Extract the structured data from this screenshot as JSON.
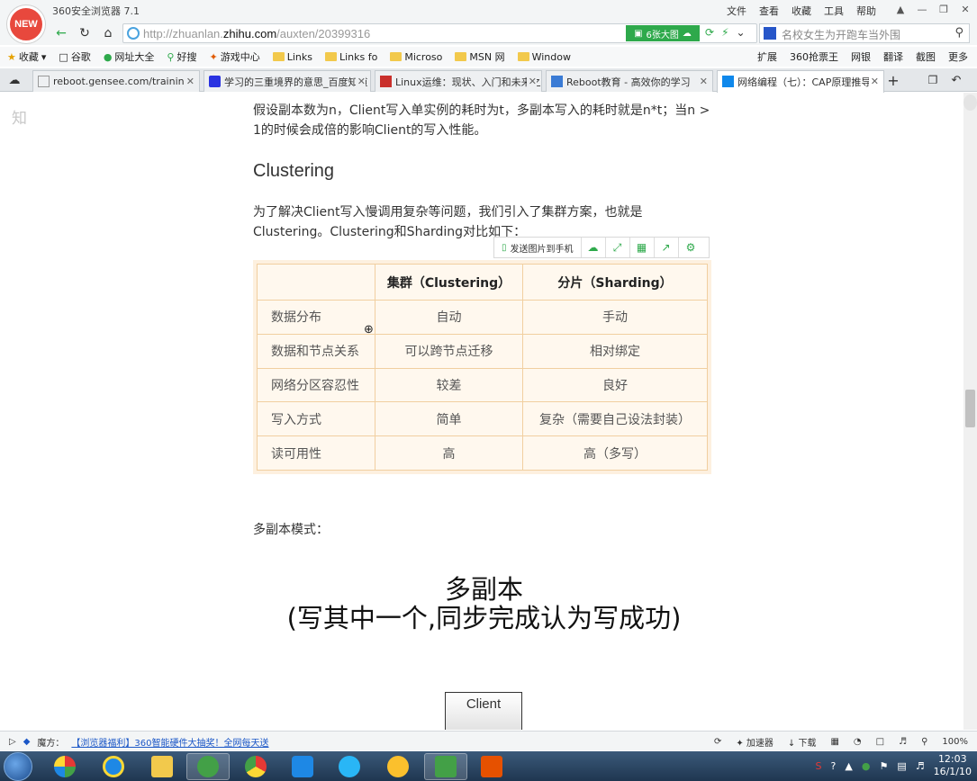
{
  "app": {
    "logo": "NEW",
    "title": "360安全浏览器 7.1"
  },
  "title_menu": [
    "文件",
    "查看",
    "收藏",
    "工具",
    "帮助"
  ],
  "window_controls": [
    "shirt-icon",
    "minimize",
    "maximize",
    "close"
  ],
  "address": {
    "url_prefix": "http://zhuanlan.",
    "url_domain": "zhihu.com",
    "url_path": "/auxten/20399316",
    "big_image_label": "6张大图",
    "search_placeholder": "名校女生为开跑车当外围"
  },
  "bookmarks": {
    "left": [
      {
        "label": "收藏",
        "icon": "star-icon"
      },
      {
        "label": "谷歌",
        "icon": "page-icon"
      },
      {
        "label": "网址大全",
        "icon": "globe-icon"
      },
      {
        "label": "好搜",
        "icon": "search-icon"
      },
      {
        "label": "游戏中心",
        "icon": "game-icon"
      },
      {
        "label": "Links",
        "icon": "folder-icon"
      },
      {
        "label": "Links fo",
        "icon": "folder-icon"
      },
      {
        "label": "Microso",
        "icon": "folder-icon"
      },
      {
        "label": "MSN 网",
        "icon": "folder-icon"
      },
      {
        "label": "Window",
        "icon": "folder-icon"
      }
    ],
    "right": [
      "扩展",
      "360抢票王",
      "网银",
      "翻译",
      "截图",
      "更多"
    ]
  },
  "tabs": [
    {
      "label": "reboot.gensee.com/training/"
    },
    {
      "label": "学习的三重境界的意思_百度知道"
    },
    {
      "label": "Linux运维：现状、入门和未来之路"
    },
    {
      "label": "Reboot教育 - 高效你的学习"
    },
    {
      "label": "网络编程（七）：CAP原理推导"
    }
  ],
  "article": {
    "site_logo": "知",
    "para1": "假设副本数为n，Client写入单实例的耗时为t，多副本写入的耗时就是n*t；当n > 1的时候会成倍的影响Client的写入性能。",
    "heading": "Clustering",
    "para2": "为了解决Client写入慢调用复杂等问题，我们引入了集群方案，也就是Clustering。Clustering和Sharding对比如下：",
    "image_toolbar": {
      "send_label": "发送图片到手机"
    },
    "table": {
      "headers": [
        "",
        "集群（Clustering）",
        "分片（Sharding）"
      ],
      "rows": [
        [
          "数据分布",
          "自动",
          "手动"
        ],
        [
          "数据和节点关系",
          "可以跨节点迁移",
          "相对绑定"
        ],
        [
          "网络分区容忍性",
          "较差",
          "良好"
        ],
        [
          "写入方式",
          "简单",
          "复杂（需要自己设法封装）"
        ],
        [
          "读可用性",
          "高",
          "高（多写）"
        ]
      ]
    },
    "mode_label": "多副本模式：",
    "diagram_title_1": "多副本",
    "diagram_title_2": "(写其中一个,同步完成认为写成功)",
    "client_label": "Client"
  },
  "status": {
    "magic_label": "魔方：",
    "promo": "【浏览器福利】360智能硬件大抽奖！全网每天送",
    "accelerator": "加速器",
    "download": "下载",
    "zoom": "100%"
  },
  "clock": {
    "time": "12:03",
    "date": "16/1/10"
  }
}
